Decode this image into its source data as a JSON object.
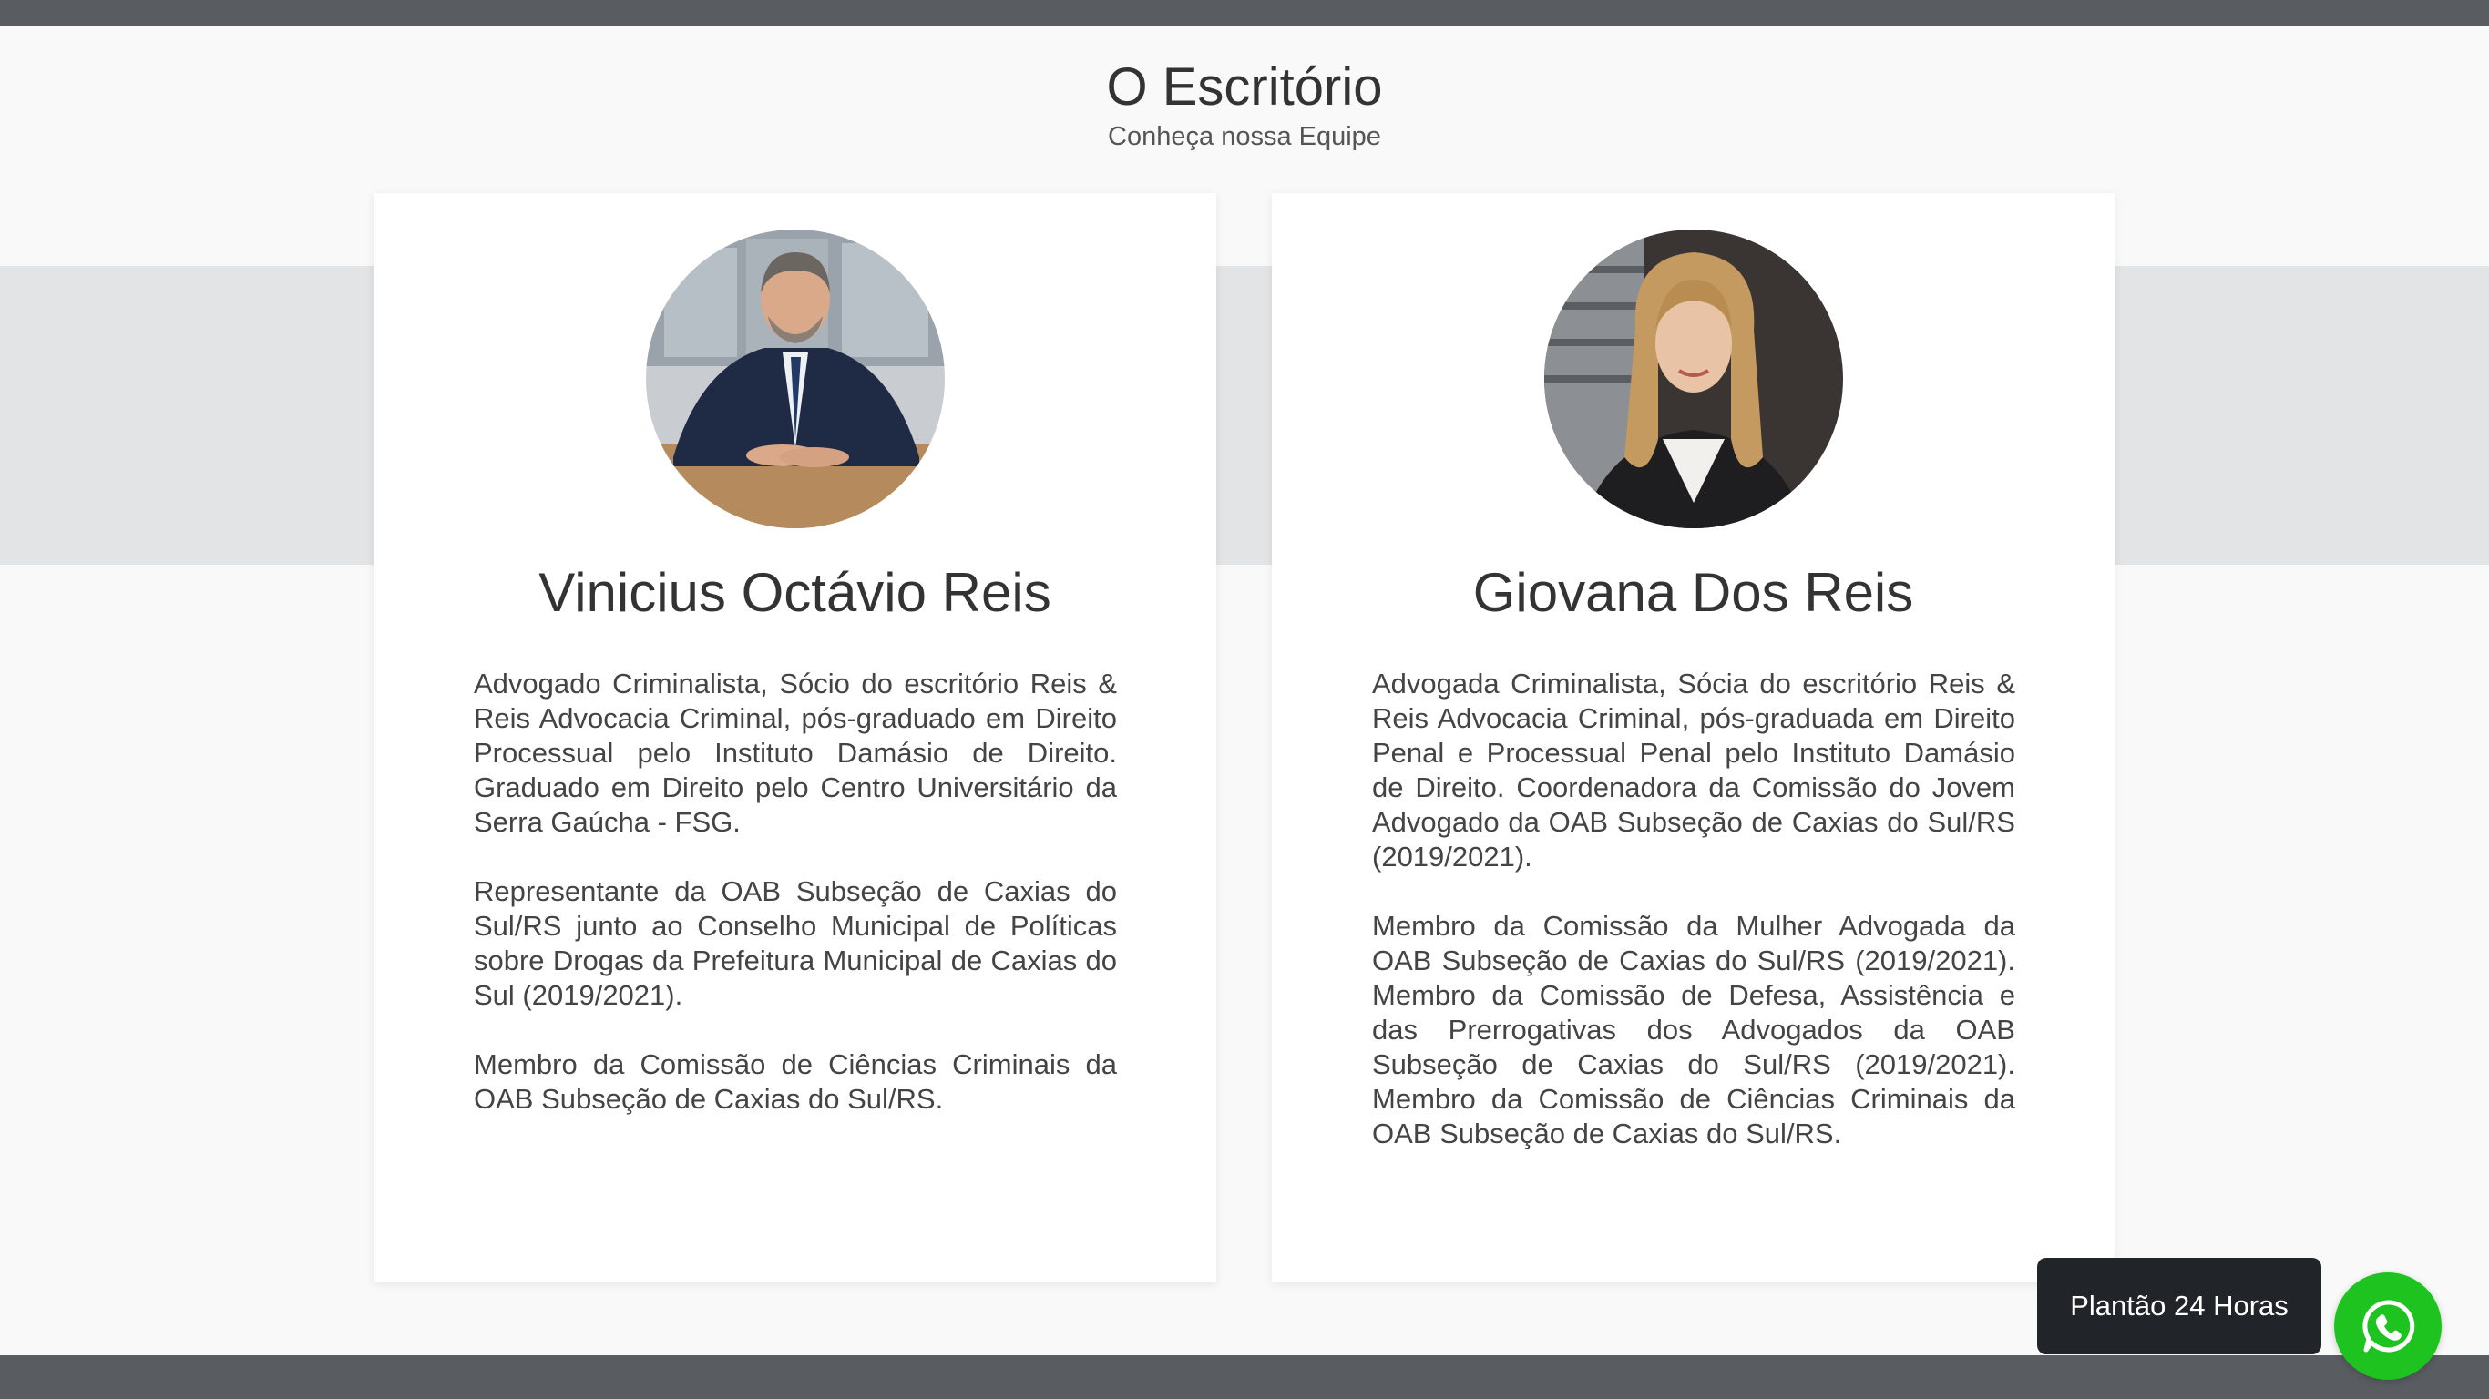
{
  "section": {
    "title": "O Escritório",
    "subtitle": "Conheça nossa Equipe"
  },
  "team": [
    {
      "name": "Vinicius Octávio Reis",
      "photo": "man-in-suit-portrait",
      "paragraphs": [
        "Advogado Criminalista, Sócio do escritório Reis & Reis Advocacia Criminal, pós-graduado em Direito Processual pelo Instituto Damásio de Direito. Graduado em Direito pelo Centro Universitário da Serra Gaúcha - FSG.",
        "Representante da OAB Subseção de Caxias do Sul/RS junto ao Conselho Municipal de Políticas sobre Drogas da Prefeitura Municipal de Caxias do Sul (2019/2021).",
        "Membro da Comissão de Ciências Criminais da OAB Subseção de Caxias do Sul/RS."
      ]
    },
    {
      "name": "Giovana Dos Reis",
      "photo": "woman-portrait",
      "paragraphs": [
        "Advogada Criminalista, Sócia do escritório Reis & Reis Advocacia Criminal, pós-graduada em Direito Penal e Processual Penal pelo Instituto Damásio de Direito. Coordenadora da Comissão do Jovem Advogado da OAB Subseção de Caxias do Sul/RS (2019/2021).",
        "Membro da Comissão da Mulher Advogada da OAB Subseção de Caxias do Sul/RS (2019/2021). Membro da Comissão de Defesa, Assistência e das Prerrogativas dos Advogados da OAB Subseção de Caxias do Sul/RS (2019/2021). Membro da Comissão de Ciências Criminais da OAB Subseção de Caxias do Sul/RS."
      ]
    }
  ],
  "floating": {
    "plantao_label": "Plantão 24 Horas",
    "whatsapp_icon": "whatsapp-icon",
    "whatsapp_color": "#1fc31f"
  },
  "colors": {
    "bars": "#595d61",
    "band": "#e3e4e6",
    "background": "#f9f9f9"
  }
}
